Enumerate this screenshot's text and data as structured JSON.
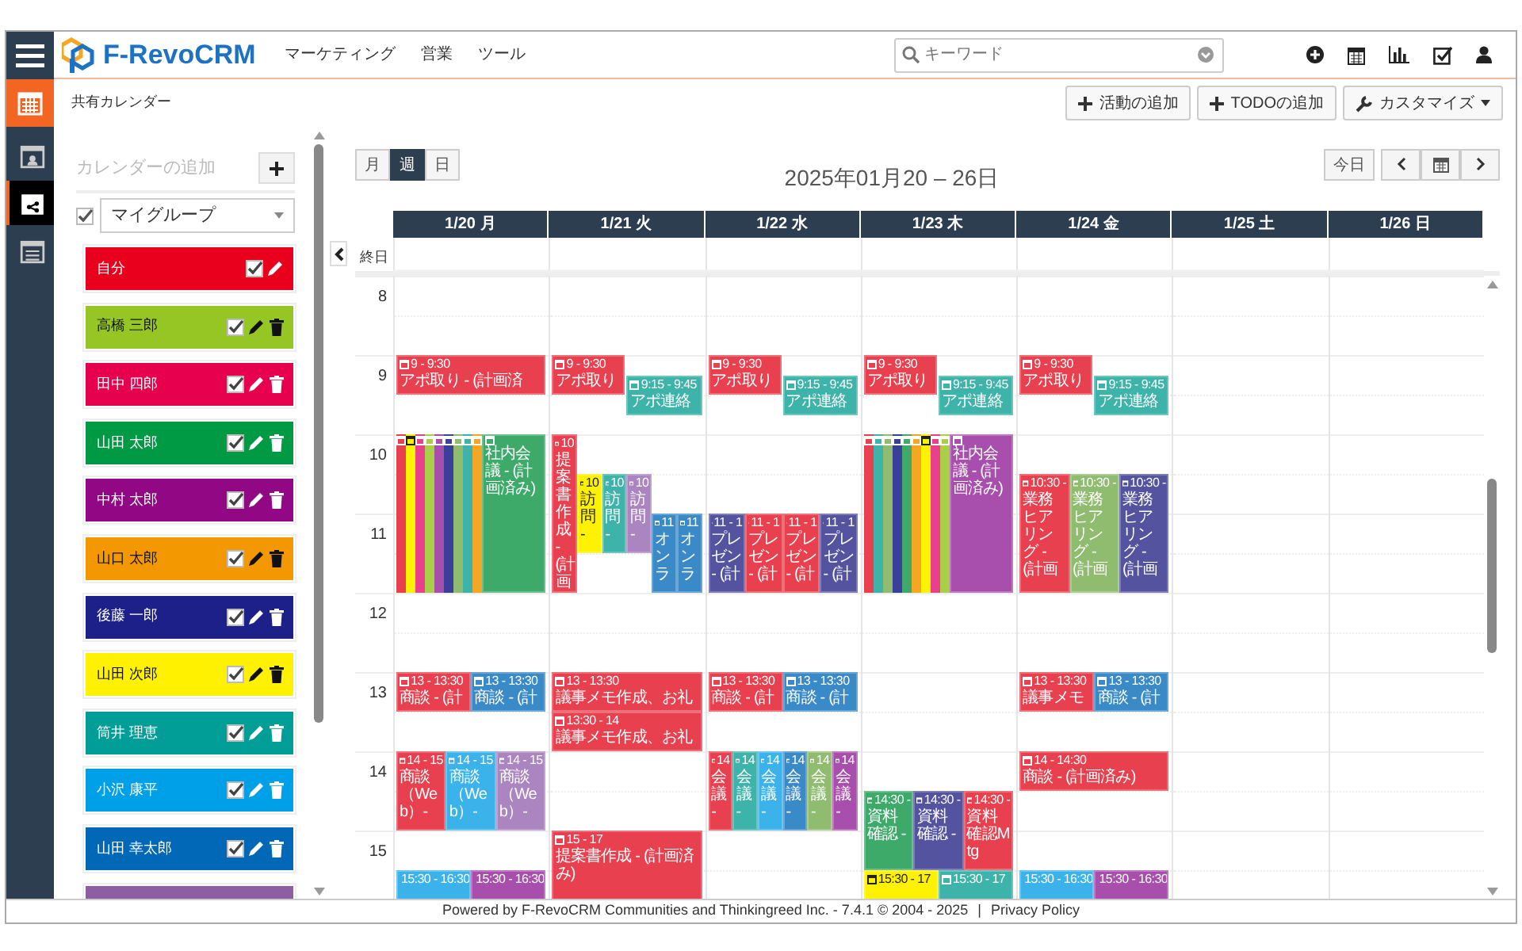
{
  "topbar": {
    "brand": "F-RevoCRM",
    "menu": [
      "マーケティング",
      "営業",
      "ツール"
    ],
    "search": {
      "placeholder": "キーワード"
    }
  },
  "subbar": {
    "title": "共有カレンダー",
    "buttons": [
      {
        "label": "活動の追加",
        "kind": "plus"
      },
      {
        "label": "TODOの追加",
        "kind": "plus"
      },
      {
        "label": "カスタマイズ",
        "kind": "wrench"
      }
    ]
  },
  "rail": [
    {
      "kind": "user",
      "selected": false
    },
    {
      "kind": "shared",
      "selected": true
    },
    {
      "kind": "list",
      "selected": false
    }
  ],
  "sidebar": {
    "title": "カレンダーの追加",
    "group": {
      "label": "マイグループ",
      "checked": true
    },
    "calendars": [
      {
        "name": "自分",
        "color": "#e8001c",
        "checked": true,
        "deletable": false
      },
      {
        "name": "高橋 三郎",
        "color": "#96c623",
        "checked": true,
        "deletable": true
      },
      {
        "name": "田中 四郎",
        "color": "#e6004e",
        "checked": true,
        "deletable": true
      },
      {
        "name": "山田 太郎",
        "color": "#009944",
        "checked": true,
        "deletable": true
      },
      {
        "name": "中村 太郎",
        "color": "#920783",
        "checked": true,
        "deletable": true
      },
      {
        "name": "山口 太郎",
        "color": "#f39800",
        "checked": true,
        "deletable": true
      },
      {
        "name": "後藤 一郎",
        "color": "#1d2088",
        "checked": true,
        "deletable": true
      },
      {
        "name": "山田 次郎",
        "color": "#fff100",
        "checked": true,
        "deletable": true
      },
      {
        "name": "筒井 理恵",
        "color": "#009e96",
        "checked": true,
        "deletable": true
      },
      {
        "name": "小沢 康平",
        "color": "#00a0e9",
        "checked": true,
        "deletable": true
      },
      {
        "name": "山田 幸太郎",
        "color": "#0068b7",
        "checked": true,
        "deletable": true
      },
      {
        "color": "#8e5ea2"
      }
    ]
  },
  "calendar": {
    "views": [
      {
        "label": "月",
        "selected": false
      },
      {
        "label": "週",
        "selected": true
      },
      {
        "label": "日",
        "selected": false
      }
    ],
    "title": "2025年01月20 – 26日",
    "today": "今日",
    "allday": "終日",
    "hours": [
      "8",
      "9",
      "10",
      "11",
      "12",
      "13",
      "14",
      "15"
    ],
    "days": [
      {
        "label": "1/20 月",
        "groups": [
          {
            "kind": "nine",
            "events": [
              {
                "kind": "half",
                "time": "9 - 9:30",
                "title": "アポ取り - (計画済",
                "color": "#e8404e"
              }
            ]
          },
          {
            "kind": "ten",
            "events": [
              {
                "kind": "strip",
                "color": "#e8404e"
              },
              {
                "kind": "strip",
                "color": "#fff200"
              },
              {
                "kind": "strip",
                "color": "#e8408a"
              },
              {
                "kind": "strip",
                "color": "#a8cf45"
              },
              {
                "kind": "strip",
                "color": "#a84fae"
              },
              {
                "kind": "strip",
                "color": "#3a3f9a"
              },
              {
                "kind": "strip",
                "color": "#8fbc6f"
              },
              {
                "kind": "strip",
                "color": "#3db3a9"
              },
              {
                "kind": "strip",
                "color": "#f5a623"
              },
              {
                "kind": "two-hours",
                "title": "社内会議 - (計画済み)",
                "color": "#3daa6a"
              }
            ]
          },
          {
            "kind": "one",
            "events": [
              {
                "kind": "half",
                "time": "13 - 13:30",
                "title": "商談 - (計",
                "color": "#e8404e"
              },
              {
                "kind": "half",
                "time": "13 - 13:30",
                "title": "商談 - (計",
                "color": "#3a8ac8"
              }
            ]
          },
          {
            "kind": "two",
            "events": [
              {
                "kind": "hour",
                "time": "14 - 15",
                "title": "商談（Web）-",
                "color": "#e8404e"
              },
              {
                "kind": "hour",
                "time": "14 - 15",
                "title": "商談（Web）-",
                "color": "#3bb3ea"
              },
              {
                "kind": "hour",
                "time": "14 - 15",
                "title": "商談（Web）-",
                "color": "#ab85c0"
              }
            ]
          },
          {
            "kind": "three-thirty",
            "events": [
              {
                "kind": "hour",
                "time": "15:30 - 16:30",
                "color": "#3bb3ea"
              },
              {
                "kind": "hour",
                "time": "15:30 - 16:30",
                "color": "#a84fae"
              }
            ]
          }
        ]
      },
      {
        "label": "1/21 火",
        "groups": [
          {
            "kind": "nine",
            "events": [
              {
                "kind": "half",
                "time": "9 - 9:30",
                "title": "アポ取り",
                "color": "#e8404e"
              },
              {
                "kind": "offset-half",
                "time": "9:15 - 9:45",
                "title": "アポ連絡",
                "color": "#3db3a9"
              }
            ]
          },
          {
            "kind": "ten",
            "events": [
              {
                "kind": "two-hours",
                "time": "10",
                "title": "提案書作成 - (計画",
                "color": "#e8404e"
              },
              {
                "kind": "later-hour",
                "time": "10",
                "title": "訪問 -",
                "color": "#fff200"
              },
              {
                "kind": "later-hour",
                "time": "10",
                "title": "訪問 -",
                "color": "#3db3a9"
              },
              {
                "kind": "later-hour",
                "time": "10",
                "title": "訪問 -",
                "color": "#ab85c0"
              },
              {
                "kind": "last-hour",
                "time": "11",
                "title": "オンラ",
                "color": "#3a8ac8"
              },
              {
                "kind": "last-hour",
                "time": "11",
                "title": "オンラ",
                "color": "#3a8ac8"
              }
            ]
          },
          {
            "kind": "one",
            "events": [
              {
                "kind": "half",
                "time": "13 - 13:30",
                "title": "議事メモ作成、お礼",
                "color": "#e8404e"
              }
            ]
          },
          {
            "kind": "one-thirty",
            "events": [
              {
                "kind": "half",
                "time": "13:30 - 14",
                "title": "議事メモ作成、お礼",
                "color": "#e8404e"
              }
            ]
          },
          {
            "kind": "three",
            "events": [
              {
                "kind": "two-hours",
                "time": "15 - 17",
                "title": "提案書作成 - (計画済み)",
                "color": "#e8404e"
              }
            ]
          }
        ]
      },
      {
        "label": "1/22 水",
        "groups": [
          {
            "kind": "nine",
            "events": [
              {
                "kind": "half",
                "time": "9 - 9:30",
                "title": "アポ取り",
                "color": "#e8404e"
              },
              {
                "kind": "offset-half",
                "time": "9:15 - 9:45",
                "title": "アポ連絡",
                "color": "#3db3a9"
              }
            ]
          },
          {
            "kind": "eleven",
            "events": [
              {
                "kind": "hour",
                "time": "11 - 1",
                "title": "プレゼン - (計",
                "color": "#5353a0"
              },
              {
                "kind": "hour",
                "time": "11 - 1",
                "title": "プレゼン - (計",
                "color": "#e8404e"
              },
              {
                "kind": "hour",
                "time": "11 - 1",
                "title": "プレゼン - (計",
                "color": "#e8404e"
              },
              {
                "kind": "hour",
                "time": "11 - 1",
                "title": "プレゼン - (計",
                "color": "#5353a0"
              }
            ]
          },
          {
            "kind": "one",
            "events": [
              {
                "kind": "half",
                "time": "13 - 13:30",
                "title": "商談 - (計",
                "color": "#e8404e"
              },
              {
                "kind": "half",
                "time": "13 - 13:30",
                "title": "商談 - (計",
                "color": "#3a8ac8"
              }
            ]
          },
          {
            "kind": "two",
            "events": [
              {
                "kind": "hour",
                "time": "14",
                "title": "会議 -",
                "color": "#e8404e"
              },
              {
                "kind": "hour",
                "time": "14",
                "title": "会議 -",
                "color": "#3db3a9"
              },
              {
                "kind": "hour",
                "time": "14",
                "title": "会議 -",
                "color": "#3bb3ea"
              },
              {
                "kind": "hour",
                "time": "14",
                "title": "会議 -",
                "color": "#3a8ac8"
              },
              {
                "kind": "hour",
                "time": "14",
                "title": "会議 -",
                "color": "#8fbc6f"
              },
              {
                "kind": "hour",
                "time": "14",
                "title": "会議 -",
                "color": "#a84fae"
              }
            ]
          }
        ]
      },
      {
        "label": "1/23 木",
        "groups": [
          {
            "kind": "nine",
            "events": [
              {
                "kind": "half",
                "time": "9 - 9:30",
                "title": "アポ取り",
                "color": "#e8404e"
              },
              {
                "kind": "offset-half",
                "time": "9:15 - 9:45",
                "title": "アポ連絡",
                "color": "#3db3a9"
              }
            ]
          },
          {
            "kind": "ten",
            "events": [
              {
                "kind": "strip",
                "color": "#e8404e"
              },
              {
                "kind": "strip",
                "color": "#3db3a9"
              },
              {
                "kind": "strip",
                "color": "#8fbc6f"
              },
              {
                "kind": "strip",
                "color": "#3a3f9a"
              },
              {
                "kind": "strip",
                "color": "#3daa6a"
              },
              {
                "kind": "strip",
                "color": "#f5a623"
              },
              {
                "kind": "strip",
                "color": "#fff200"
              },
              {
                "kind": "strip",
                "color": "#e8408a"
              },
              {
                "kind": "strip",
                "color": "#a8cf45"
              },
              {
                "kind": "two-hours",
                "title": "社内会議 - (計画済み)",
                "color": "#a84fae"
              }
            ]
          },
          {
            "kind": "two-thirty",
            "events": [
              {
                "kind": "hour",
                "time": "14:30 -",
                "title": "資料確認 -",
                "color": "#3daa6a"
              },
              {
                "kind": "hour",
                "time": "14:30 -",
                "title": "資料確認 -",
                "color": "#5353a0"
              },
              {
                "kind": "hour",
                "time": "14:30 -",
                "title": "資料確認Mtg",
                "color": "#e8404e"
              }
            ]
          },
          {
            "kind": "three-thirty",
            "events": [
              {
                "kind": "hour",
                "time": "15:30 - 17",
                "color": "#fff200"
              },
              {
                "kind": "hour",
                "time": "15:30 - 17",
                "color": "#3db3a9"
              }
            ]
          }
        ]
      },
      {
        "label": "1/24 金",
        "groups": [
          {
            "kind": "nine",
            "events": [
              {
                "kind": "half",
                "time": "9 - 9:30",
                "title": "アポ取り",
                "color": "#e8404e"
              },
              {
                "kind": "offset-half",
                "time": "9:15 - 9:45",
                "title": "アポ連絡",
                "color": "#3db3a9"
              }
            ]
          },
          {
            "kind": "ten-thirty",
            "events": [
              {
                "kind": "ninety",
                "time": "10:30 -",
                "title": "業務ヒアリング - (計画",
                "color": "#e8404e"
              },
              {
                "kind": "ninety",
                "time": "10:30 -",
                "title": "業務ヒアリング - (計画",
                "color": "#8fbc6f"
              },
              {
                "kind": "ninety",
                "time": "10:30 -",
                "title": "業務ヒアリング - (計画",
                "color": "#5353a0"
              }
            ]
          },
          {
            "kind": "one",
            "events": [
              {
                "kind": "half",
                "time": "13 - 13:30",
                "title": "議事メモ",
                "color": "#e8404e"
              },
              {
                "kind": "half",
                "time": "13 - 13:30",
                "title": "商談 - (計",
                "color": "#3a8ac8"
              }
            ]
          },
          {
            "kind": "two",
            "events": [
              {
                "kind": "half",
                "time": "14 - 14:30",
                "title": "商談 - (計画済み)",
                "color": "#e8404e"
              }
            ]
          },
          {
            "kind": "three-thirty",
            "events": [
              {
                "kind": "hour",
                "time": "15:30 - 16:30",
                "color": "#3bb3ea"
              },
              {
                "kind": "hour",
                "time": "15:30 - 16:30",
                "color": "#a84fae"
              }
            ]
          }
        ]
      },
      {
        "label": "1/25 土"
      },
      {
        "label": "1/26 日"
      }
    ]
  },
  "footer": {
    "text": "Powered by F-RevoCRM Communities and Thinkingreed Inc. - 7.4.1  © 2004 - 2025",
    "separator": "|",
    "link": "Privacy Policy"
  }
}
